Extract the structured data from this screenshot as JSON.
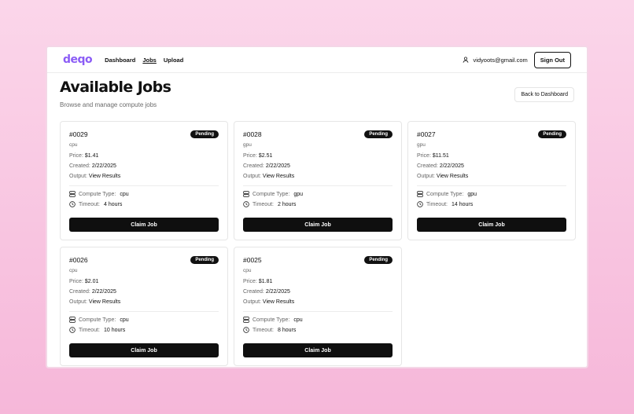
{
  "nav": {
    "logo": "deqo",
    "links": [
      "Dashboard",
      "Jobs",
      "Upload"
    ],
    "user_email": "vidyoots@gmail.com",
    "signout": "Sign Out"
  },
  "header": {
    "title": "Available Jobs",
    "subtitle": "Browse and manage compute jobs",
    "back": "Back to Dashboard"
  },
  "labels": {
    "price": "Price:",
    "created": "Created:",
    "output": "Output:",
    "output_link": "View Results",
    "compute": "Compute Type:",
    "timeout": "Timeout:",
    "claim": "Claim Job"
  },
  "jobs": [
    {
      "id": "#0029",
      "status": "Pending",
      "type": "cpu",
      "price": "$1.41",
      "created": "2/22/2025",
      "timeout": "4 hours"
    },
    {
      "id": "#0028",
      "status": "Pending",
      "type": "gpu",
      "price": "$2.51",
      "created": "2/22/2025",
      "timeout": "2 hours"
    },
    {
      "id": "#0027",
      "status": "Pending",
      "type": "gpu",
      "price": "$11.51",
      "created": "2/22/2025",
      "timeout": "14 hours"
    },
    {
      "id": "#0026",
      "status": "Pending",
      "type": "cpu",
      "price": "$2.01",
      "created": "2/22/2025",
      "timeout": "10 hours"
    },
    {
      "id": "#0025",
      "status": "Pending",
      "type": "cpu",
      "price": "$1.81",
      "created": "2/22/2025",
      "timeout": "8 hours"
    }
  ],
  "colors": {
    "logo": "#8b5cf6",
    "button": "#0f0f0f",
    "background_top": "#fbd6ea",
    "background_bottom": "#f6b7d9"
  }
}
